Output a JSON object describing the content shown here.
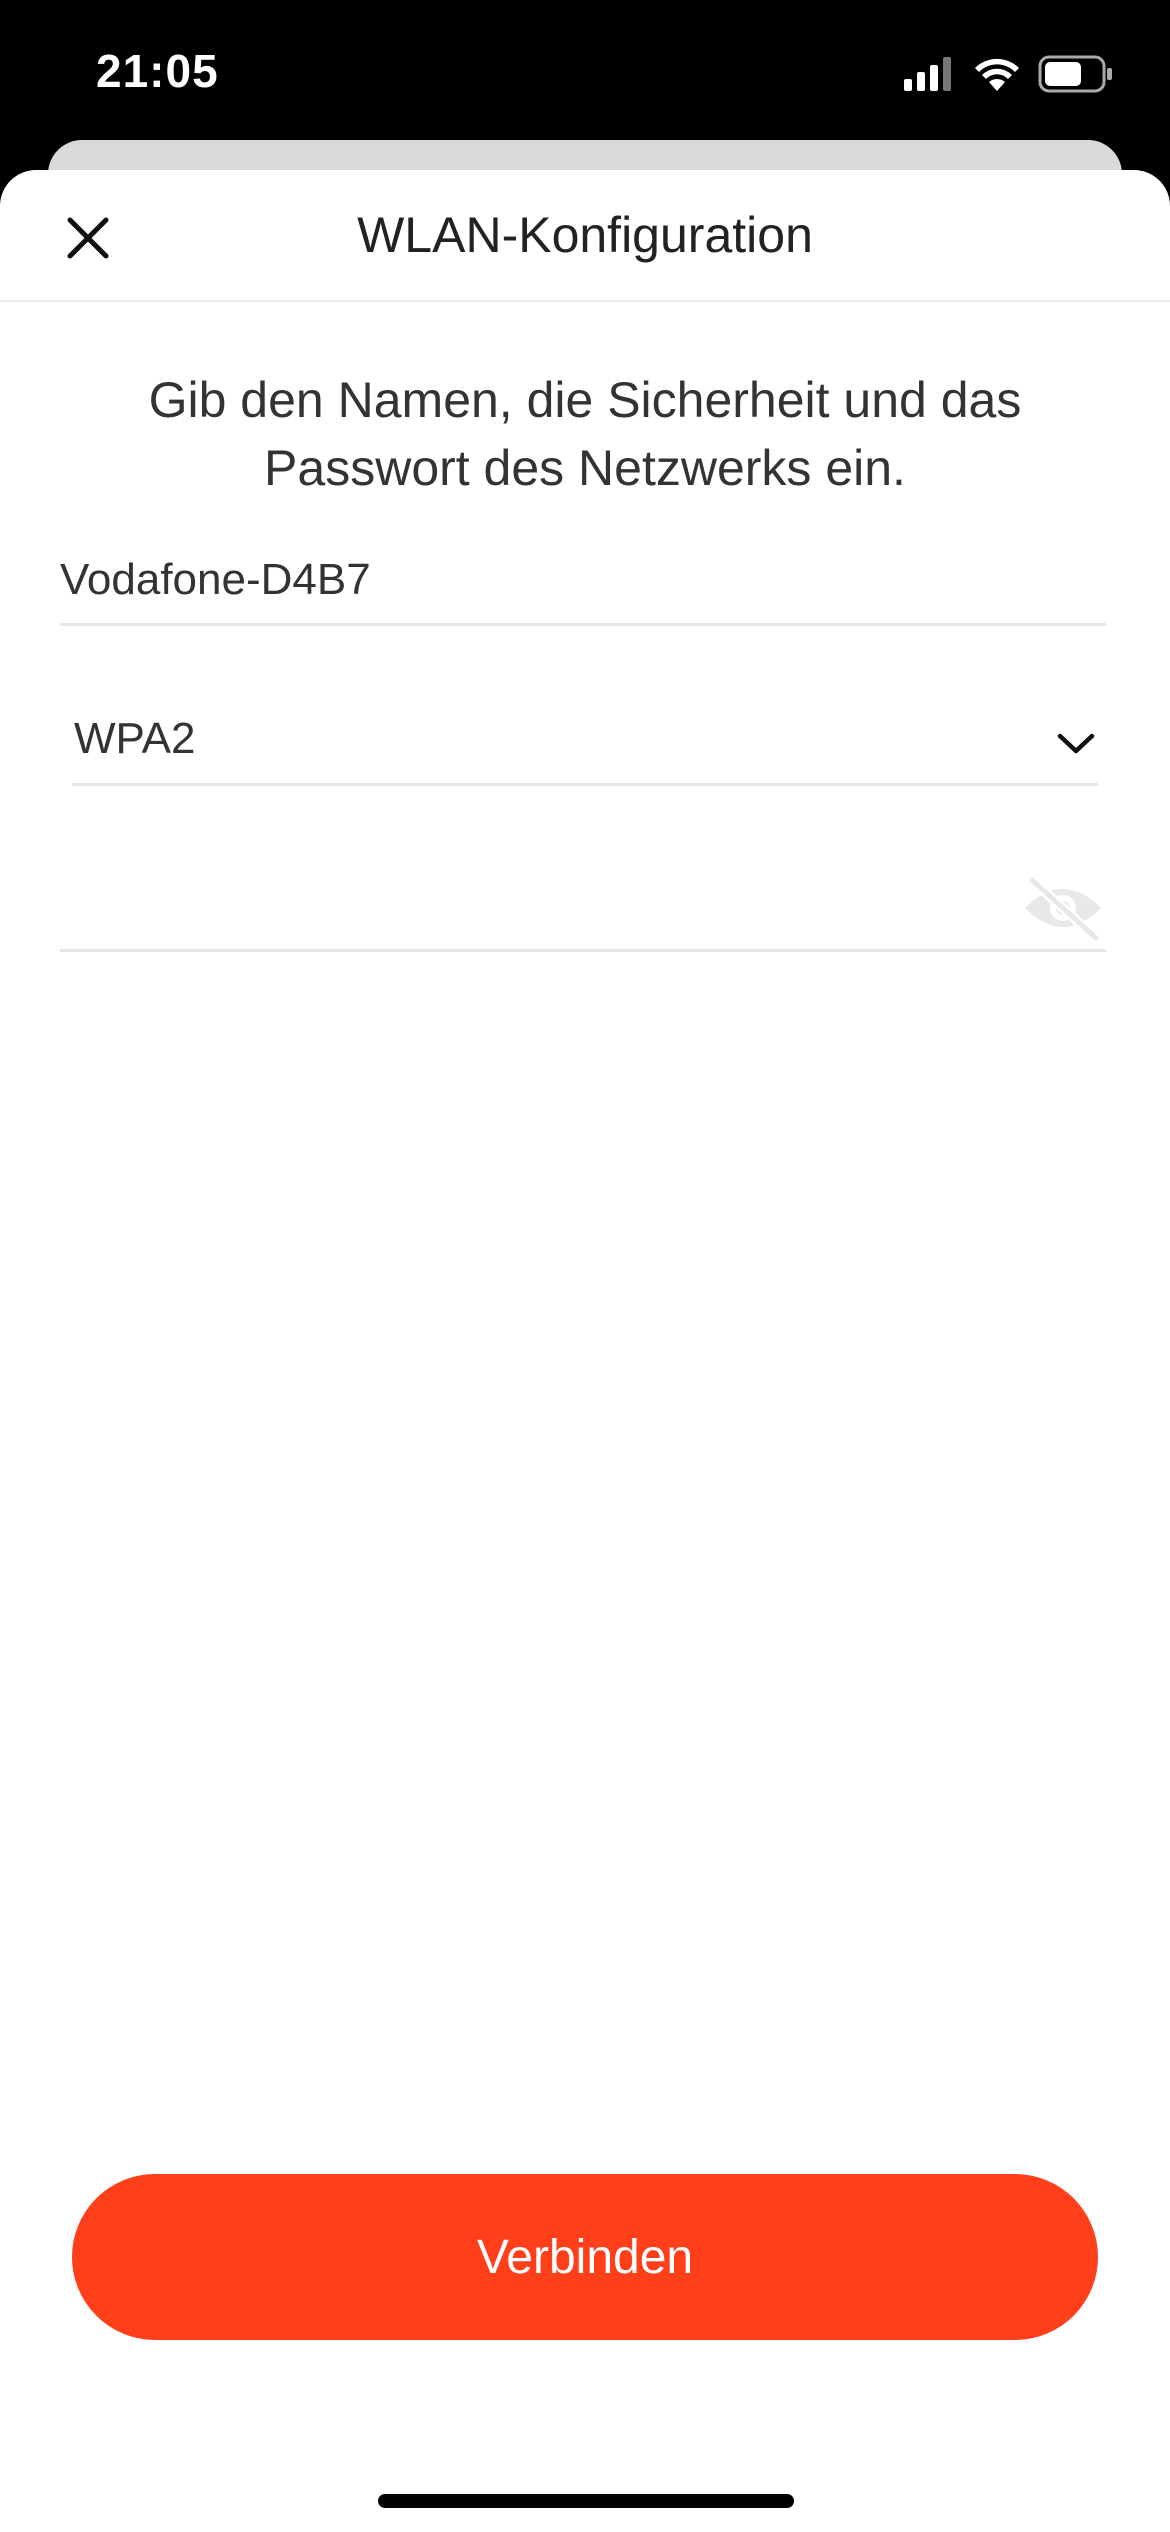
{
  "status_bar": {
    "time": "21:05"
  },
  "nav": {
    "title": "WLAN-Konfiguration",
    "close_icon": "close-icon"
  },
  "instructions": {
    "text": "Gib den Namen, die Sicherheit und das Passwort des Netzwerks ein."
  },
  "form": {
    "ssid_value": "Vodafone-D4B7",
    "security_value": "WPA2",
    "password_value": "",
    "password_toggle_icon": "eye-off-icon"
  },
  "actions": {
    "connect_label": "Verbinden"
  },
  "colors": {
    "accent": "#ff3e1a",
    "text": "#333333",
    "divider": "#e6e6e6"
  }
}
